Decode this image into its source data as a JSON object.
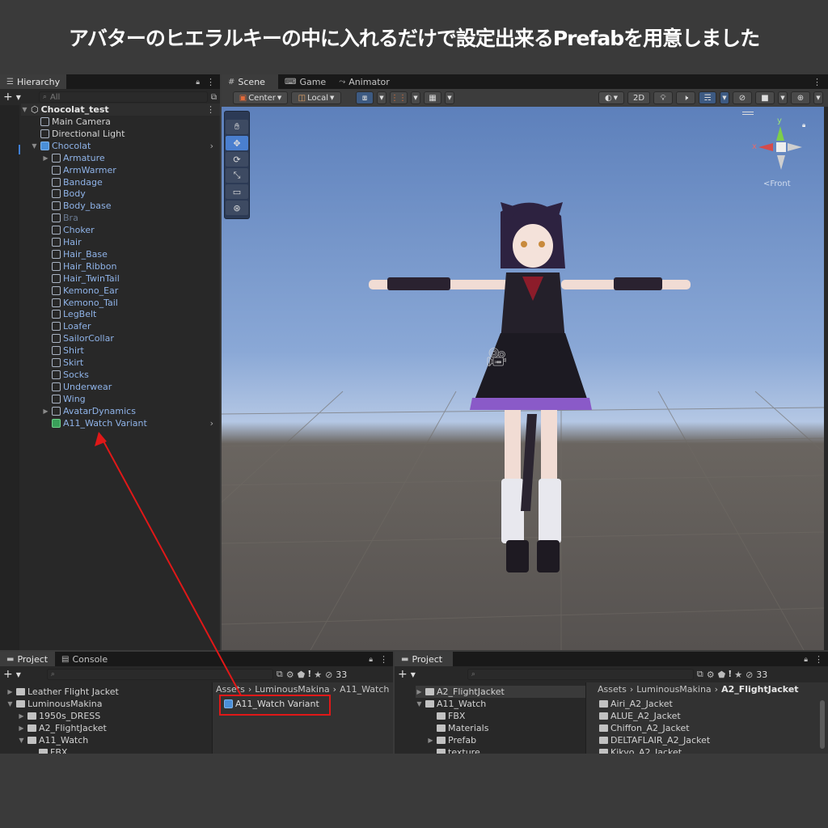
{
  "banner": {
    "title": "アバターのヒエラルキーの中に入れるだけで設定出来るPrefabを用意しました"
  },
  "hierarchy": {
    "tab_label": "Hierarchy",
    "search_placeholder": "All",
    "scene_name": "Chocolat_test",
    "items": [
      {
        "label": "Main Camera",
        "depth": 1,
        "style": "plain"
      },
      {
        "label": "Directional Light",
        "depth": 1,
        "style": "plain"
      },
      {
        "label": "Chocolat",
        "depth": 1,
        "style": "prefab",
        "expanded": true
      },
      {
        "label": "Armature",
        "depth": 2,
        "style": "prefab",
        "collapsed": true
      },
      {
        "label": "ArmWarmer",
        "depth": 2,
        "style": "prefab"
      },
      {
        "label": "Bandage",
        "depth": 2,
        "style": "prefab"
      },
      {
        "label": "Body",
        "depth": 2,
        "style": "prefab"
      },
      {
        "label": "Body_base",
        "depth": 2,
        "style": "prefab"
      },
      {
        "label": "Bra",
        "depth": 2,
        "style": "disabled"
      },
      {
        "label": "Choker",
        "depth": 2,
        "style": "prefab"
      },
      {
        "label": "Hair",
        "depth": 2,
        "style": "prefab"
      },
      {
        "label": "Hair_Base",
        "depth": 2,
        "style": "prefab"
      },
      {
        "label": "Hair_Ribbon",
        "depth": 2,
        "style": "prefab"
      },
      {
        "label": "Hair_TwinTail",
        "depth": 2,
        "style": "prefab"
      },
      {
        "label": "Kemono_Ear",
        "depth": 2,
        "style": "prefab"
      },
      {
        "label": "Kemono_Tail",
        "depth": 2,
        "style": "prefab"
      },
      {
        "label": "LegBelt",
        "depth": 2,
        "style": "prefab"
      },
      {
        "label": "Loafer",
        "depth": 2,
        "style": "prefab"
      },
      {
        "label": "SailorCollar",
        "depth": 2,
        "style": "prefab"
      },
      {
        "label": "Shirt",
        "depth": 2,
        "style": "prefab"
      },
      {
        "label": "Skirt",
        "depth": 2,
        "style": "prefab"
      },
      {
        "label": "Socks",
        "depth": 2,
        "style": "prefab"
      },
      {
        "label": "Underwear",
        "depth": 2,
        "style": "prefab"
      },
      {
        "label": "Wing",
        "depth": 2,
        "style": "prefab"
      },
      {
        "label": "AvatarDynamics",
        "depth": 2,
        "style": "prefab",
        "collapsed": true
      },
      {
        "label": "A11_Watch Variant",
        "depth": 2,
        "style": "variant"
      }
    ]
  },
  "scene_view": {
    "tabs": [
      {
        "label": "Scene",
        "icon": "grid-icon"
      },
      {
        "label": "Game",
        "icon": "gamepad-icon"
      },
      {
        "label": "Animator",
        "icon": "animator-icon"
      }
    ],
    "pivot_mode": "Center",
    "pivot_rotation": "Local",
    "mode_2d": "2D",
    "gizmo_label": "Front",
    "gizmo_axis_x": "x",
    "gizmo_axis_y": "y"
  },
  "project_left": {
    "tabs": [
      "Project",
      "Console"
    ],
    "breadcrumb": [
      "Assets",
      "LuminousMakina",
      "A11_Watch"
    ],
    "count": "33",
    "tree": [
      {
        "label": "Leather Flight Jacket",
        "depth": 0
      },
      {
        "label": "LuminousMakina",
        "depth": 0,
        "expanded": true
      },
      {
        "label": "1950s_DRESS",
        "depth": 1
      },
      {
        "label": "A2_FlightJacket",
        "depth": 1
      },
      {
        "label": "A11_Watch",
        "depth": 1,
        "expanded": true
      },
      {
        "label": "FBX",
        "depth": 2
      }
    ],
    "asset": "A11_Watch Variant"
  },
  "project_right": {
    "tab": "Project",
    "count": "33",
    "breadcrumb": [
      "Assets",
      "LuminousMakina",
      "A2_FlightJacket"
    ],
    "tree": [
      {
        "label": "A2_FlightJacket",
        "depth": 0
      },
      {
        "label": "A11_Watch",
        "depth": 0,
        "expanded": true
      },
      {
        "label": "FBX",
        "depth": 1
      },
      {
        "label": "Materials",
        "depth": 1
      },
      {
        "label": "Prefab",
        "depth": 1
      },
      {
        "label": "texture",
        "depth": 1
      }
    ],
    "assets": [
      "Airi_A2_Jacket",
      "ALUE_A2_Jacket",
      "Chiffon_A2_Jacket",
      "DELTAFLAIR_A2_Jacket",
      "Kikyo_A2_Jacket"
    ]
  },
  "colors": {
    "annotation": "#e01818",
    "prefab_text": "#8fb3e8",
    "selection": "#3d5a82"
  }
}
